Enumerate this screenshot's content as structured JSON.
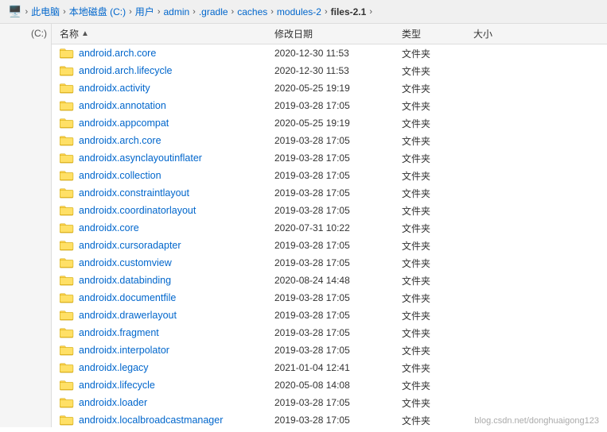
{
  "addressBar": {
    "items": [
      {
        "label": "此电脑",
        "icon": "computer-icon"
      },
      {
        "label": "本地磁盘 (C:)",
        "icon": "disk-icon"
      },
      {
        "label": "用户",
        "icon": null
      },
      {
        "label": "admin",
        "icon": null
      },
      {
        "label": ".gradle",
        "icon": null
      },
      {
        "label": "caches",
        "icon": null
      },
      {
        "label": "modules-2",
        "icon": null
      },
      {
        "label": "files-2.1",
        "icon": null
      }
    ]
  },
  "leftPanel": {
    "label": "(C:)"
  },
  "columns": {
    "name": "名称",
    "date": "修改日期",
    "type": "类型",
    "size": "大小"
  },
  "files": [
    {
      "name": "android.arch.core",
      "date": "2020-12-30 11:53",
      "type": "文件夹",
      "size": ""
    },
    {
      "name": "android.arch.lifecycle",
      "date": "2020-12-30 11:53",
      "type": "文件夹",
      "size": ""
    },
    {
      "name": "androidx.activity",
      "date": "2020-05-25 19:19",
      "type": "文件夹",
      "size": ""
    },
    {
      "name": "androidx.annotation",
      "date": "2019-03-28 17:05",
      "type": "文件夹",
      "size": ""
    },
    {
      "name": "androidx.appcompat",
      "date": "2020-05-25 19:19",
      "type": "文件夹",
      "size": ""
    },
    {
      "name": "androidx.arch.core",
      "date": "2019-03-28 17:05",
      "type": "文件夹",
      "size": ""
    },
    {
      "name": "androidx.asynclayoutinflater",
      "date": "2019-03-28 17:05",
      "type": "文件夹",
      "size": ""
    },
    {
      "name": "androidx.collection",
      "date": "2019-03-28 17:05",
      "type": "文件夹",
      "size": ""
    },
    {
      "name": "androidx.constraintlayout",
      "date": "2019-03-28 17:05",
      "type": "文件夹",
      "size": ""
    },
    {
      "name": "androidx.coordinatorlayout",
      "date": "2019-03-28 17:05",
      "type": "文件夹",
      "size": ""
    },
    {
      "name": "androidx.core",
      "date": "2020-07-31 10:22",
      "type": "文件夹",
      "size": ""
    },
    {
      "name": "androidx.cursoradapter",
      "date": "2019-03-28 17:05",
      "type": "文件夹",
      "size": ""
    },
    {
      "name": "androidx.customview",
      "date": "2019-03-28 17:05",
      "type": "文件夹",
      "size": ""
    },
    {
      "name": "androidx.databinding",
      "date": "2020-08-24 14:48",
      "type": "文件夹",
      "size": ""
    },
    {
      "name": "androidx.documentfile",
      "date": "2019-03-28 17:05",
      "type": "文件夹",
      "size": ""
    },
    {
      "name": "androidx.drawerlayout",
      "date": "2019-03-28 17:05",
      "type": "文件夹",
      "size": ""
    },
    {
      "name": "androidx.fragment",
      "date": "2019-03-28 17:05",
      "type": "文件夹",
      "size": ""
    },
    {
      "name": "androidx.interpolator",
      "date": "2019-03-28 17:05",
      "type": "文件夹",
      "size": ""
    },
    {
      "name": "androidx.legacy",
      "date": "2021-01-04 12:41",
      "type": "文件夹",
      "size": ""
    },
    {
      "name": "androidx.lifecycle",
      "date": "2020-05-08 14:08",
      "type": "文件夹",
      "size": ""
    },
    {
      "name": "androidx.loader",
      "date": "2019-03-28 17:05",
      "type": "文件夹",
      "size": ""
    },
    {
      "name": "androidx.localbroadcastmanager",
      "date": "2019-03-28 17:05",
      "type": "文件夹",
      "size": ""
    }
  ],
  "watermark": "blog.csdn.net/donghuaigong123"
}
